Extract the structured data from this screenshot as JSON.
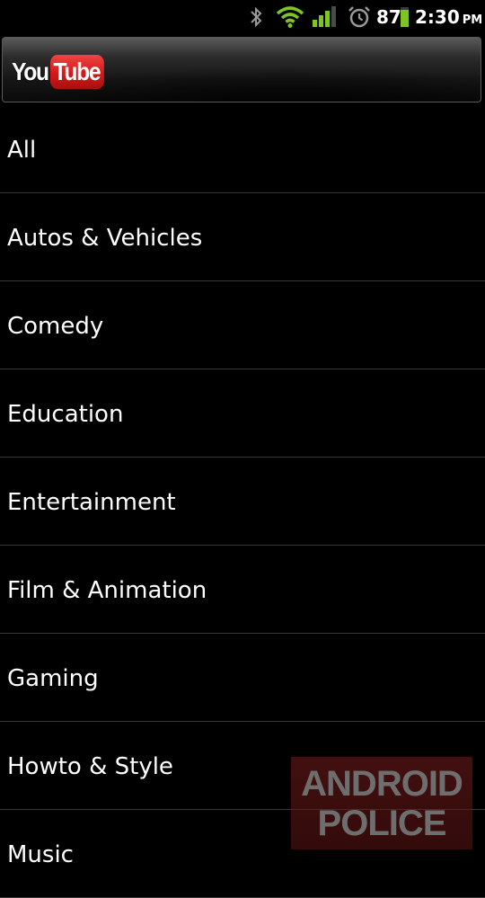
{
  "status_bar": {
    "battery_percent": "87",
    "time": "2:30",
    "ampm": "PM",
    "icons": [
      "bluetooth-icon",
      "wifi-icon",
      "signal-icon",
      "alarm-icon",
      "battery-icon"
    ],
    "battery_color": "#7ec424"
  },
  "title_bar": {
    "logo_you": "You",
    "logo_tube": "Tube",
    "logo_red": "#d61d1d"
  },
  "categories": [
    {
      "label": "All"
    },
    {
      "label": "Autos & Vehicles"
    },
    {
      "label": "Comedy"
    },
    {
      "label": "Education"
    },
    {
      "label": "Entertainment"
    },
    {
      "label": "Film & Animation"
    },
    {
      "label": "Gaming"
    },
    {
      "label": "Howto & Style"
    },
    {
      "label": "Music"
    }
  ],
  "watermark": {
    "line1": "ANDROID",
    "line2": "POLICE"
  }
}
